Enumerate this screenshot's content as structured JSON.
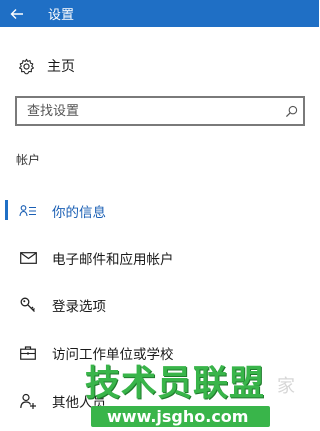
{
  "window": {
    "title": "设置",
    "accent": "#1f6fc5"
  },
  "home": {
    "label": "主页",
    "icon": "gear-icon"
  },
  "search": {
    "placeholder": "查找设置",
    "value": "",
    "icon": "search-icon"
  },
  "section": {
    "title": "帐户"
  },
  "nav": {
    "items": [
      {
        "label": "你的信息",
        "icon": "person-card-icon",
        "selected": true
      },
      {
        "label": "电子邮件和应用帐户",
        "icon": "mail-icon",
        "selected": false
      },
      {
        "label": "登录选项",
        "icon": "key-icon",
        "selected": false
      },
      {
        "label": "访问工作单位或学校",
        "icon": "briefcase-icon",
        "selected": false
      },
      {
        "label": "其他人员",
        "icon": "add-person-icon",
        "selected": false
      }
    ]
  },
  "watermark": {
    "main": "技术员联盟",
    "url": "www.jsgho.com",
    "faint": "家"
  }
}
